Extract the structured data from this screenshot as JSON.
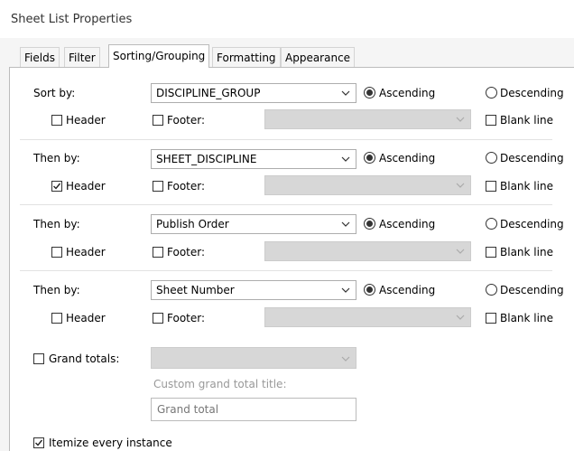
{
  "dialog": {
    "title": "Sheet List Properties"
  },
  "tabs": [
    {
      "label": "Fields",
      "active": false
    },
    {
      "label": "Filter",
      "active": false
    },
    {
      "label": "Sorting/Grouping",
      "active": true
    },
    {
      "label": "Formatting",
      "active": false
    },
    {
      "label": "Appearance",
      "active": false
    }
  ],
  "sort_rows": [
    {
      "label": "Sort by:",
      "field": "DISCIPLINE_GROUP",
      "order": "Ascending",
      "header_checked": false
    },
    {
      "label": "Then by:",
      "field": "SHEET_DISCIPLINE",
      "order": "Ascending",
      "header_checked": true
    },
    {
      "label": "Then by:",
      "field": "Publish Order",
      "order": "Ascending",
      "header_checked": false
    },
    {
      "label": "Then by:",
      "field": "Sheet Number",
      "order": "Ascending",
      "header_checked": false
    }
  ],
  "row_labels": {
    "ascending": "Ascending",
    "descending": "Descending",
    "header": "Header",
    "footer": "Footer:",
    "blank_line": "Blank line"
  },
  "grand_totals": {
    "label": "Grand totals:",
    "checked": false,
    "custom_title_label": "Custom grand total title:",
    "custom_title_value": "Grand total"
  },
  "itemize": {
    "label": "Itemize every instance",
    "checked": true
  },
  "colors": {
    "disabled_fill": "#d7d7d7",
    "panel_bg": "#ffffff",
    "dialog_bg": "#f5f5f5"
  }
}
